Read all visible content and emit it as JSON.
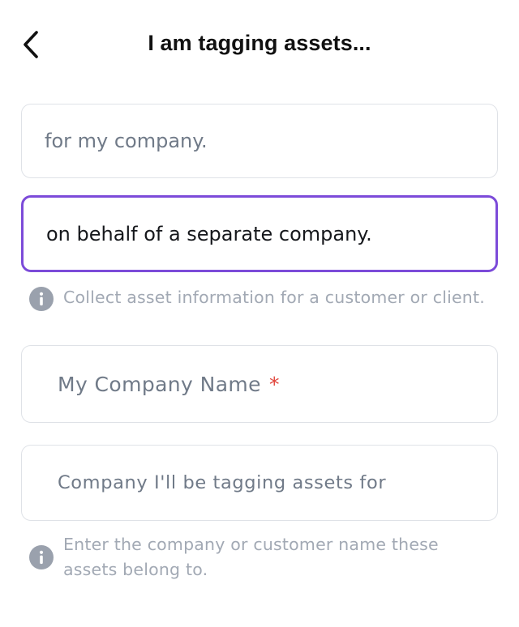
{
  "header": {
    "title": "I am tagging assets...",
    "back_icon": "chevron-left-icon"
  },
  "options": [
    {
      "label": "for my company.",
      "selected": false
    },
    {
      "label": "on behalf of a separate company.",
      "selected": true
    }
  ],
  "options_hint": {
    "icon": "info-icon",
    "text": "Collect asset information for a customer or client."
  },
  "fields": {
    "my_company": {
      "label": "My Company Name",
      "required_mark": "*"
    },
    "client_company": {
      "label": "Company I'll be tagging assets for"
    }
  },
  "client_hint": {
    "icon": "info-icon",
    "text": "Enter the company or customer name these assets belong to."
  },
  "colors": {
    "accent": "#7c4bd9",
    "required": "#e1463c",
    "border": "#dfe2e7",
    "muted_text": "#a2a9b4",
    "placeholder_text": "#707a88"
  }
}
